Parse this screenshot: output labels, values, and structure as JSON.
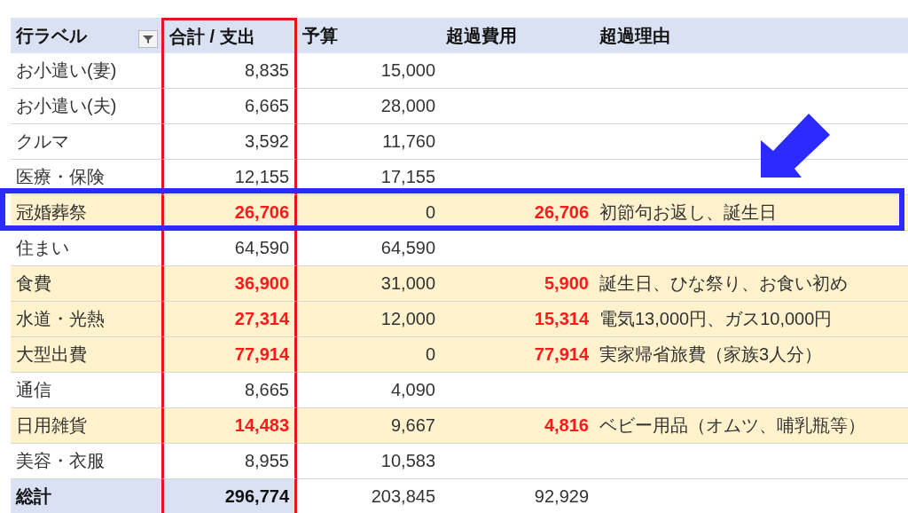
{
  "arrow": true,
  "columns": [
    {
      "label": "行ラベル",
      "filter": true,
      "outlined": false
    },
    {
      "label": "合計 / 支出",
      "filter": false,
      "outlined": true
    },
    {
      "label": "予算",
      "filter": false,
      "outlined": false
    },
    {
      "label": "超過費用",
      "filter": false,
      "outlined": false
    },
    {
      "label": "超過理由",
      "filter": false,
      "outlined": false
    }
  ],
  "rows": [
    {
      "kind": "item",
      "over": false,
      "callout": false,
      "cells": [
        "お小遣い(妻)",
        "8,835",
        "15,000"
      ]
    },
    {
      "kind": "item",
      "over": false,
      "callout": false,
      "cells": [
        "お小遣い(夫)",
        "6,665",
        "28,000"
      ]
    },
    {
      "kind": "item",
      "over": false,
      "callout": false,
      "cells": [
        "クルマ",
        "3,592",
        "11,760"
      ]
    },
    {
      "kind": "item",
      "over": false,
      "callout": false,
      "cells": [
        "医療・保険",
        "12,155",
        "17,155"
      ]
    },
    {
      "kind": "item",
      "over": true,
      "callout": true,
      "cells": [
        "冠婚葬祭",
        "26,706",
        "0",
        "26,706",
        "初節句お返し、誕生日"
      ]
    },
    {
      "kind": "item",
      "over": false,
      "callout": false,
      "cells": [
        "住まい",
        "64,590",
        "64,590"
      ]
    },
    {
      "kind": "item",
      "over": true,
      "callout": false,
      "cells": [
        "食費",
        "36,900",
        "31,000",
        "5,900",
        "誕生日、ひな祭り、お食い初め"
      ]
    },
    {
      "kind": "item",
      "over": true,
      "callout": false,
      "cells": [
        "水道・光熱",
        "27,314",
        "12,000",
        "15,314",
        "電気13,000円、ガス10,000円"
      ]
    },
    {
      "kind": "item",
      "over": true,
      "callout": false,
      "cells": [
        "大型出費",
        "77,914",
        "0",
        "77,914",
        "実家帰省旅費（家族3人分）"
      ]
    },
    {
      "kind": "item",
      "over": false,
      "callout": false,
      "cells": [
        "通信",
        "8,665",
        "4,090"
      ]
    },
    {
      "kind": "item",
      "over": true,
      "callout": false,
      "cells": [
        "日用雑貨",
        "14,483",
        "9,667",
        "4,816",
        "ベビー用品（オムツ、哺乳瓶等）"
      ]
    },
    {
      "kind": "item",
      "over": false,
      "callout": false,
      "cells": [
        "美容・衣服",
        "8,955",
        "10,583"
      ]
    },
    {
      "kind": "total",
      "over": false,
      "callout": false,
      "cells": [
        "総計",
        "296,774",
        "203,845",
        "92,929"
      ]
    }
  ]
}
